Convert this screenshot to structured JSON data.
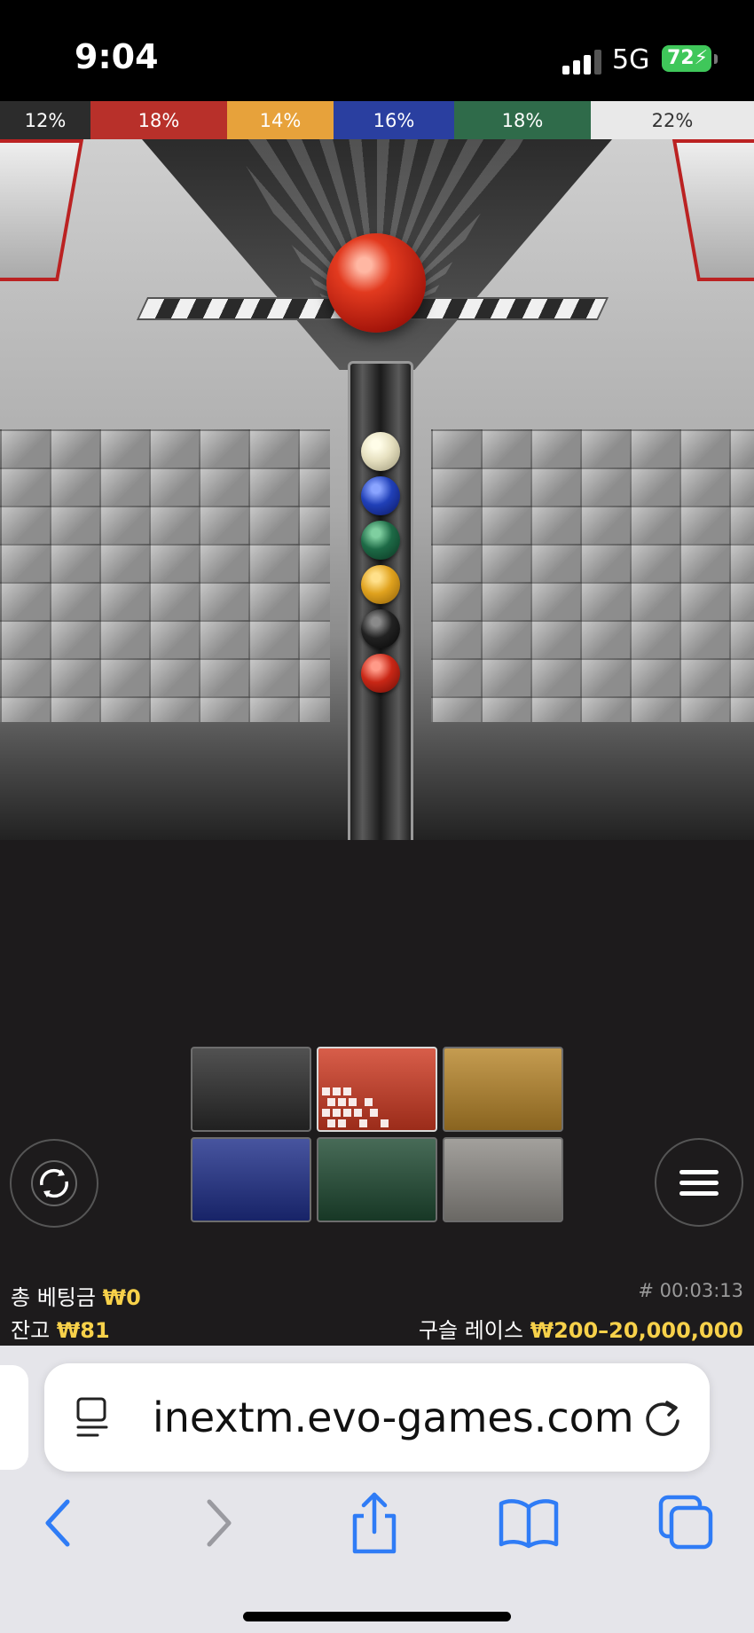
{
  "status_bar": {
    "time": "9:04",
    "network": "5G",
    "battery": "72"
  },
  "odds": [
    {
      "label": "12%",
      "color": "#2c2c2c"
    },
    {
      "label": "18%",
      "color": "#b8302a"
    },
    {
      "label": "14%",
      "color": "#e7a23b"
    },
    {
      "label": "16%",
      "color": "#2a3fa0"
    },
    {
      "label": "18%",
      "color": "#2f6b4a"
    },
    {
      "label": "22%",
      "color": "#e9e9e9"
    }
  ],
  "tube_balls": [
    "white",
    "blue",
    "green",
    "yellow",
    "black",
    "red"
  ],
  "bet_options": [
    {
      "name": "black",
      "color": "#2b2b2b"
    },
    {
      "name": "red",
      "color": "#cf3a22"
    },
    {
      "name": "yellow",
      "color": "#b8862a"
    },
    {
      "name": "blue",
      "color": "#1f2f8a"
    },
    {
      "name": "green",
      "color": "#1f4a32"
    },
    {
      "name": "white",
      "color": "#8e8b86"
    }
  ],
  "bet_info": {
    "total_bet_label": "총 베팅금",
    "total_bet_value": "₩0",
    "balance_label": "잔고",
    "balance_value": "₩81",
    "round_id": "# 00:03:13",
    "limits_label": "구슬 레이스",
    "limits_value": "₩200–20,000,000"
  },
  "browser": {
    "url": "inextm.evo-games.com"
  },
  "colors": {
    "accent_gold": "#f7d14a",
    "safari_blue": "#2f7cf6"
  }
}
